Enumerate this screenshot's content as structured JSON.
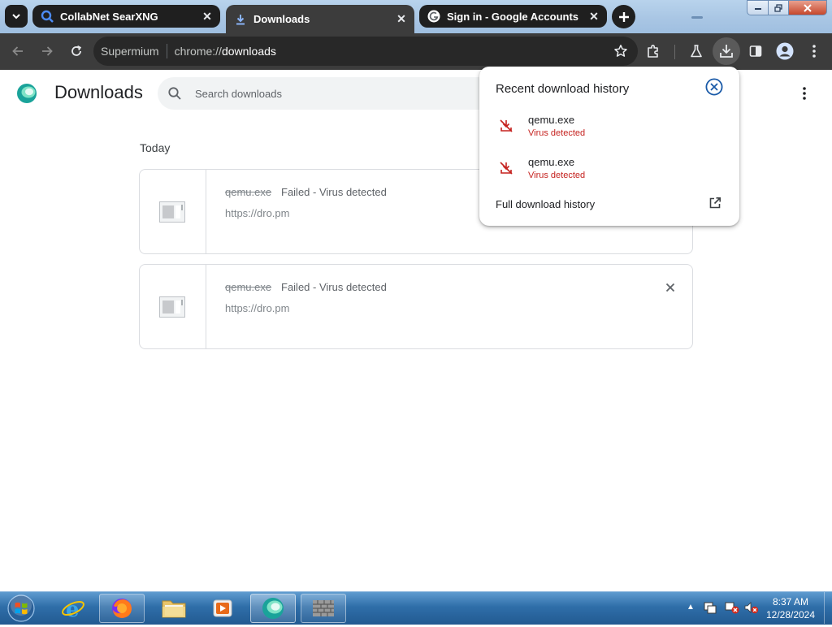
{
  "browser": {
    "tabs": [
      {
        "label": "CollabNet SearXNG",
        "favicon": "search-icon",
        "active": false
      },
      {
        "label": "Downloads",
        "favicon": "download-icon",
        "active": true
      },
      {
        "label": "Sign in - Google Accounts",
        "favicon": "google-g-icon",
        "active": false
      }
    ],
    "omnibox": {
      "brand": "Supermium",
      "scheme": "chrome://",
      "host": "downloads"
    }
  },
  "page": {
    "title": "Downloads",
    "search_placeholder": "Search downloads",
    "section_label": "Today",
    "items": [
      {
        "filename": "qemu.exe",
        "status": "Failed - Virus detected",
        "url": "https://dro.pm"
      },
      {
        "filename": "qemu.exe",
        "status": "Failed - Virus detected",
        "url": "https://dro.pm"
      }
    ]
  },
  "bubble": {
    "title": "Recent download history",
    "items": [
      {
        "name": "qemu.exe",
        "status": "Virus detected"
      },
      {
        "name": "qemu.exe",
        "status": "Virus detected"
      }
    ],
    "full_history_label": "Full download history"
  },
  "taskbar": {
    "time": "8:37 AM",
    "date": "12/28/2024"
  },
  "colors": {
    "accent": "#1a73e8",
    "danger": "#c5221f",
    "toolbar": "#3c3c3c",
    "tab_inactive": "#1f1f1f"
  }
}
